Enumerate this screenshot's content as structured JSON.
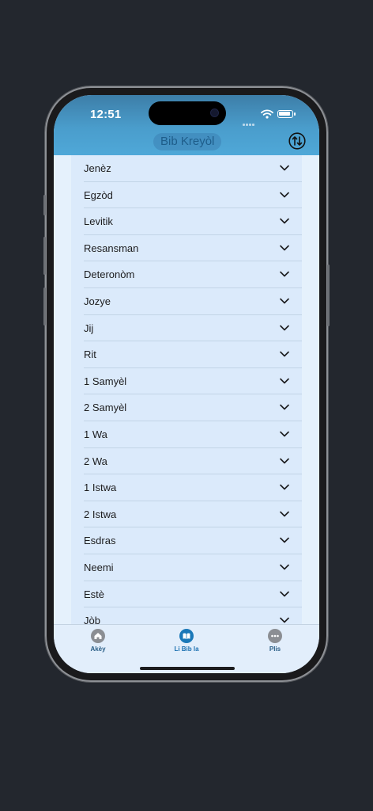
{
  "status_bar": {
    "time": "12:51"
  },
  "header": {
    "title": "Bib Kreyòl",
    "sort_icon": "swap-vertical-icon",
    "accent": "#4a9dcc"
  },
  "books": [
    "Jenèz",
    "Egzòd",
    "Levitik",
    "Resansman",
    "Deteronòm",
    "Jozye",
    "Jij",
    "Rit",
    "1 Samyèl",
    "2 Samyèl",
    "1 Wa",
    "2 Wa",
    "1 Istwa",
    "2 Istwa",
    "Esdras",
    "Neemi",
    "Estè",
    "Jòb"
  ],
  "tabbar": {
    "items": [
      {
        "label": "Akèy",
        "icon": "home-icon",
        "active": false
      },
      {
        "label": "Li Bib la",
        "icon": "book-icon",
        "active": true
      },
      {
        "label": "Plis",
        "icon": "more-icon",
        "active": false
      }
    ],
    "active_color": "#1a78b8"
  }
}
